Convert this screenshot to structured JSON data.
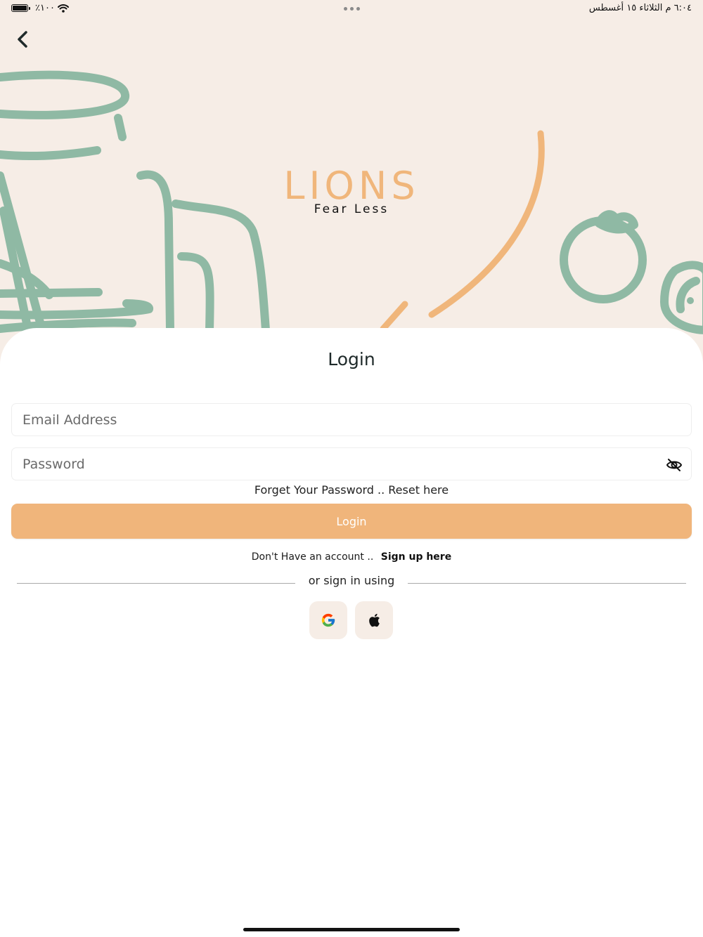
{
  "status_bar": {
    "battery": "٪١٠٠",
    "time_date": "٦:٠٤ م   الثلاثاء ١٥ أغسطس"
  },
  "icons": {
    "back": "chevron-left-icon",
    "wifi": "wifi-icon",
    "battery": "battery-icon",
    "eye": "eye-off-icon",
    "google": "google-icon",
    "apple": "apple-icon"
  },
  "brand": {
    "title": "LIONS",
    "tagline": "Fear Less",
    "colors": {
      "accent": "#f0b57b",
      "green": "#8fb9a4",
      "hero_bg": "#f6ede6"
    }
  },
  "login": {
    "title": "Login",
    "email_placeholder": "Email Address",
    "password_placeholder": "Password",
    "forgot_prefix": "Forget Your Password .. ",
    "forgot_link": "Reset here",
    "button_label": "Login",
    "signup_prefix": "Don't Have an account .. ",
    "signup_link": "Sign up here",
    "divider_text": "or sign in using"
  }
}
